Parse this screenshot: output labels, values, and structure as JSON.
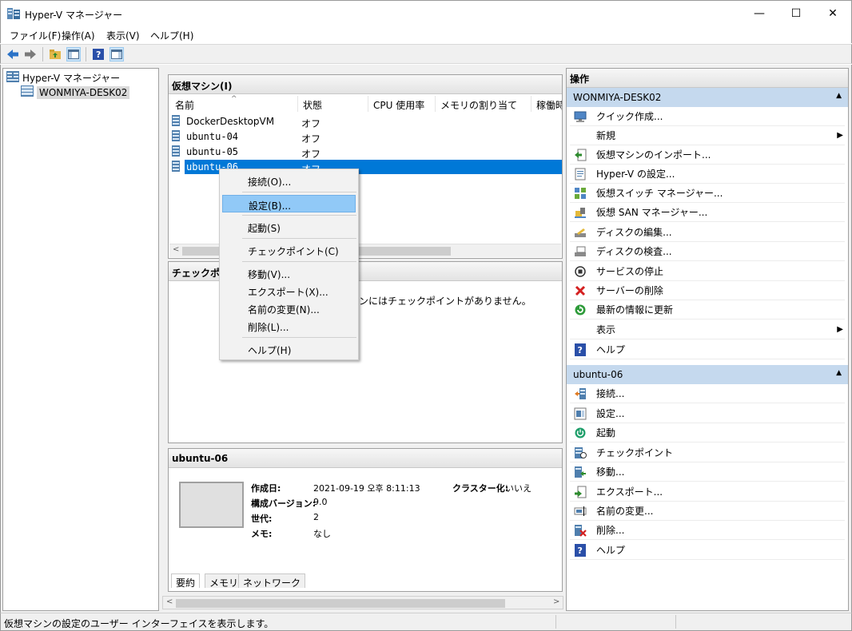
{
  "window": {
    "title": "Hyper-V マネージャー",
    "controls": {
      "minimize": "—",
      "maximize": "☐",
      "close": "✕"
    }
  },
  "menu": [
    "ファイル(F)",
    "操作(A)",
    "表示(V)",
    "ヘルプ(H)"
  ],
  "tree": {
    "root": "Hyper-V マネージャー",
    "server": "WONMIYA-DESK02"
  },
  "vm_panel": {
    "title": "仮想マシン(I)",
    "columns": [
      "名前",
      "状態",
      "CPU 使用率",
      "メモリの割り当て",
      "稼働時"
    ],
    "rows": [
      {
        "name": "DockerDesktopVM",
        "state": "オフ"
      },
      {
        "name": "ubuntu-04",
        "state": "オフ"
      },
      {
        "name": "ubuntu-05",
        "state": "オフ"
      },
      {
        "name": "ubuntu-06",
        "state": "オフ"
      }
    ]
  },
  "checkpoint_panel": {
    "title": "チェックポイ",
    "empty_message": "ンにはチェックポイントがありません。"
  },
  "context_menu": {
    "connect": "接続(O)...",
    "settings": "設定(B)...",
    "start": "起動(S)",
    "checkpoint": "チェックポイント(C)",
    "move": "移動(V)...",
    "export": "エクスポート(X)...",
    "rename": "名前の変更(N)...",
    "delete": "削除(L)...",
    "help": "ヘルプ(H)"
  },
  "details": {
    "title": "ubuntu-06",
    "created_label": "作成日:",
    "created_value": "2021-09-19 오후 8:11:13",
    "config_label": "構成バージョン:",
    "config_value": "9.0",
    "generation_label": "世代:",
    "generation_value": "2",
    "notes_label": "メモ:",
    "notes_value": "なし",
    "cluster_label": "クラスター化:",
    "cluster_value": "いいえ",
    "tabs": [
      "要約",
      "メモリ",
      "ネットワーク"
    ]
  },
  "actions": {
    "title": "操作",
    "server_header": "WONMIYA-DESK02",
    "server_items": [
      "クイック作成...",
      "新規",
      "仮想マシンのインポート...",
      "Hyper-V の設定...",
      "仮想スイッチ マネージャー...",
      "仮想 SAN マネージャー...",
      "ディスクの編集...",
      "ディスクの検査...",
      "サービスの停止",
      "サーバーの削除",
      "最新の情報に更新",
      "表示",
      "ヘルプ"
    ],
    "vm_header": "ubuntu-06",
    "vm_items": [
      "接続...",
      "設定...",
      "起動",
      "チェックポイント",
      "移動...",
      "エクスポート...",
      "名前の変更...",
      "削除...",
      "ヘルプ"
    ]
  },
  "status": "仮想マシンの設定のユーザー インターフェイスを表示します。",
  "colors": {
    "selection": "#0078d7",
    "menu_hover": "#91c9f7",
    "action_header": "#c5d9ee"
  }
}
